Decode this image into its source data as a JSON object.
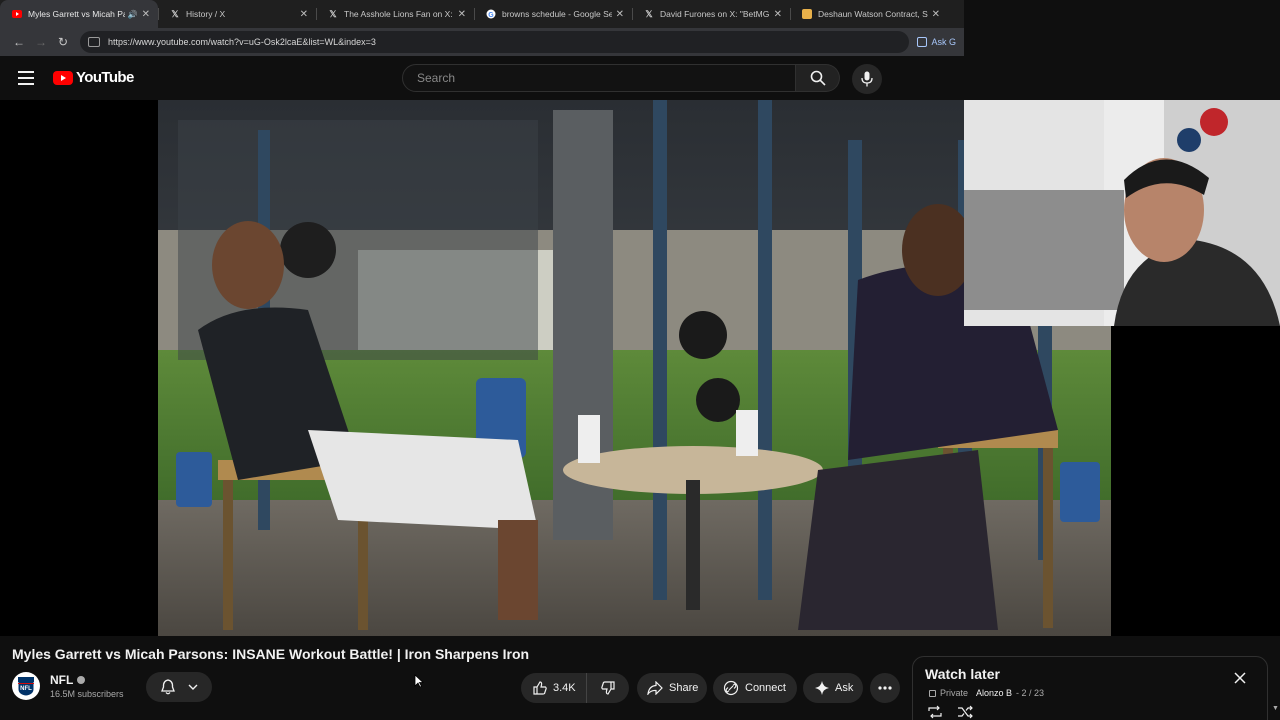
{
  "browser": {
    "tabs": [
      {
        "title": "Myles Garrett vs Micah Par",
        "favicon": "youtube-icon",
        "active": true,
        "audio": true
      },
      {
        "title": "History / X",
        "favicon": "x-icon"
      },
      {
        "title": "The Asshole Lions Fan on X: \"ht",
        "favicon": "x-icon"
      },
      {
        "title": "browns schedule - Google Sear",
        "favicon": "google-icon"
      },
      {
        "title": "David Furones on X: \"BetMGM",
        "favicon": "x-icon"
      },
      {
        "title": "Deshaun Watson Contract, Sala",
        "favicon": "spotrac-icon"
      }
    ],
    "url": "https://www.youtube.com/watch?v=uG-Osk2lcaE&list=WL&index=3",
    "ask_label": "Ask G"
  },
  "youtube": {
    "logo_text": "YouTube",
    "search_placeholder": "Search"
  },
  "video": {
    "title": "Myles Garrett vs Micah Parsons: INSANE Workout Battle! | Iron Sharpens Iron",
    "channel": "NFL",
    "subscribers": "16.5M subscribers",
    "likes": "3.4K",
    "share_label": "Share",
    "connect_label": "Connect",
    "ask_label": "Ask"
  },
  "watch_later": {
    "title": "Watch later",
    "privacy": "Private",
    "owner": "Alonzo B",
    "position": "- 2 / 23"
  },
  "colors": {
    "brand": "#ff0000",
    "background": "#0f0f0f",
    "pill": "#272727"
  }
}
